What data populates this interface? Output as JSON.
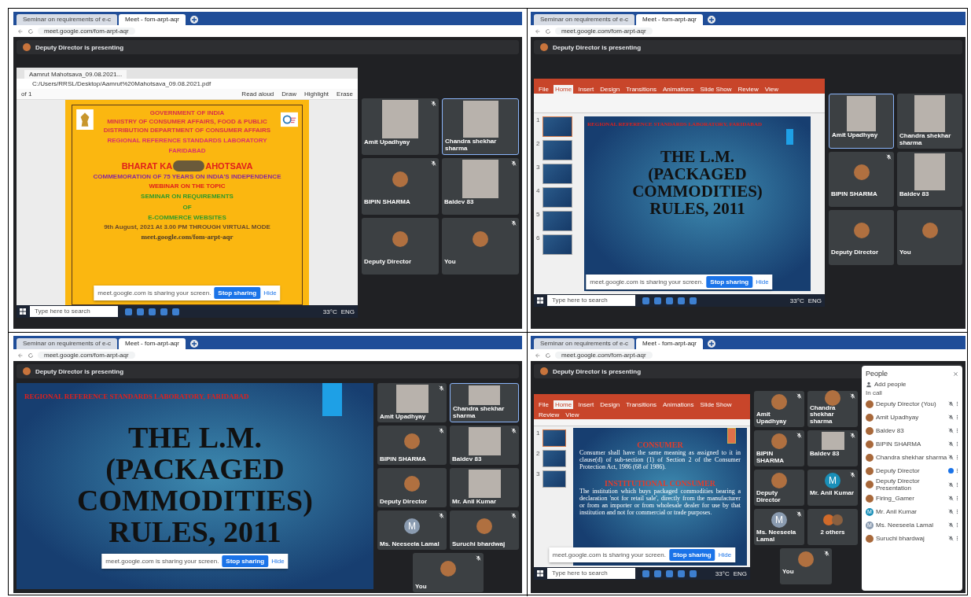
{
  "panels": [
    {
      "browser": {
        "tabs": [
          {
            "title": "Seminar on requirements of e-c",
            "selected": false
          },
          {
            "title": "Meet - fom-arpt-aqr",
            "selected": true
          }
        ],
        "url": "meet.google.com/fom-arpt-aqr"
      },
      "presenting": "Deputy Director is presenting",
      "share": {
        "kind": "pdf",
        "tab": "Aamrut Mahotsava_09.08.2021...",
        "path": "C:/Users/RRSL/Desktop/Aamrut%20Mahotsava_09.08.2021.pdf",
        "page_count": "of 1",
        "tools": [
          "Read aloud",
          "Draw",
          "Highlight",
          "Erase"
        ],
        "lines": [
          {
            "kind": "small",
            "text": "GOVERNMENT OF INDIA",
            "color": "#d8324a"
          },
          {
            "kind": "small",
            "text": "MINISTRY OF CONSUMER AFFAIRS, FOOD & PUBLIC",
            "color": "#d8324a"
          },
          {
            "kind": "small",
            "text": "DISTRIBUTION DEPARTMENT OF CONSUMER AFFAIRS",
            "color": "#d8324a"
          },
          {
            "kind": "medium",
            "text": "REGIONAL REFERENCE STANDARDS LABORATORY",
            "color": "#d8326e"
          },
          {
            "kind": "medium",
            "text": "FARIDABAD",
            "color": "#d8326e"
          },
          {
            "kind": "covered",
            "before": "BHARAT KA",
            "after": "AHOTSAVA",
            "color": "#e0201c"
          },
          {
            "kind": "small",
            "text": "COMMEMORATION OF 75 YEARS ON INDIA'S INDEPENDENCE",
            "color": "#8a2a9a"
          },
          {
            "kind": "medium",
            "text": "WEBINAR ON THE TOPIC",
            "color": "#e0201c"
          },
          {
            "kind": "medium",
            "text": "SEMINAR ON REQUIREMENTS",
            "color": "#2f9a2a"
          },
          {
            "kind": "medium",
            "text": "OF",
            "color": "#2f9a2a"
          },
          {
            "kind": "medium",
            "text": "E-COMMERCE WEBSITES",
            "color": "#2f9a2a"
          },
          {
            "kind": "small",
            "text": "9th August, 2021 At 3.00 PM THROUGH VIRTUAL MODE",
            "color": "#6a4a2a"
          },
          {
            "kind": "serif",
            "text": "meet.google.com/fom-arpt-aqr",
            "color": "#4a3a2a"
          }
        ],
        "taskbar": {
          "search": "Type here to search",
          "weather": "33°C",
          "language": "ENG"
        },
        "share_bar": {
          "message": "meet.google.com is sharing your screen.",
          "stop": "Stop sharing",
          "hide": "Hide"
        }
      },
      "tiles": [
        {
          "name": "Amit Upadhyay",
          "kind": "video",
          "highlighted": false,
          "muted": true
        },
        {
          "name": "Chandra shekhar sharma",
          "kind": "video",
          "highlighted": true,
          "muted": false
        },
        {
          "name": "BIPIN SHARMA",
          "kind": "avatar",
          "highlighted": false,
          "muted": true
        },
        {
          "name": "Baldev 83",
          "kind": "video",
          "highlighted": false,
          "muted": true
        },
        {
          "name": "Deputy Director",
          "kind": "avatar",
          "highlighted": false,
          "muted": false
        },
        {
          "name": "You",
          "kind": "avatar",
          "highlighted": false,
          "muted": true
        }
      ]
    },
    {
      "browser": {
        "tabs": [
          {
            "title": "Seminar on requirements of e-c",
            "selected": false
          },
          {
            "title": "Meet - fom-arpt-aqr",
            "selected": true
          }
        ],
        "url": "meet.google.com/fom-arpt-aqr"
      },
      "presenting": "Deputy Director is presenting",
      "share": {
        "kind": "ppt",
        "ribbon_tabs": [
          {
            "label": "File",
            "selected": false
          },
          {
            "label": "Home",
            "selected": true
          },
          {
            "label": "Insert",
            "selected": false
          },
          {
            "label": "Design",
            "selected": false
          },
          {
            "label": "Transitions",
            "selected": false
          },
          {
            "label": "Animations",
            "selected": false
          },
          {
            "label": "Slide Show",
            "selected": false
          },
          {
            "label": "Review",
            "selected": false
          },
          {
            "label": "View",
            "selected": false
          }
        ],
        "thumbnails": [
          {
            "number": "1",
            "selected": true
          },
          {
            "number": "2",
            "selected": false
          },
          {
            "number": "3",
            "selected": false
          },
          {
            "number": "4",
            "selected": false
          },
          {
            "number": "5",
            "selected": false
          },
          {
            "number": "6",
            "selected": false
          }
        ],
        "slide": {
          "kind": "title",
          "header": "REGIONAL REFERENCE STANDARDS LABORATORY, FARIDABAD",
          "lines": [
            "THE L.M.",
            "(PACKAGED",
            "COMMODITIES)",
            "RULES, 2011"
          ]
        },
        "taskbar": {
          "search": "Type here to search",
          "weather": "33°C",
          "language": "ENG"
        },
        "share_bar": {
          "message": "meet.google.com is sharing your screen.",
          "stop": "Stop sharing",
          "hide": "Hide"
        }
      },
      "tiles": [
        {
          "name": "Amit Upadhyay",
          "kind": "video",
          "highlighted": true,
          "muted": false
        },
        {
          "name": "Chandra shekhar sharma",
          "kind": "video",
          "highlighted": false,
          "muted": false
        },
        {
          "name": "BIPIN SHARMA",
          "kind": "avatar",
          "highlighted": false,
          "muted": true
        },
        {
          "name": "Baldev 83",
          "kind": "video",
          "highlighted": false,
          "muted": false
        },
        {
          "name": "Deputy Director",
          "kind": "avatar",
          "highlighted": false,
          "muted": false
        },
        {
          "name": "You",
          "kind": "avatar",
          "highlighted": false,
          "muted": false
        }
      ]
    },
    {
      "browser": {
        "tabs": [
          {
            "title": "Seminar on requirements of e-c",
            "selected": false
          },
          {
            "title": "Meet - fom-arpt-aqr",
            "selected": true
          }
        ],
        "url": "meet.google.com/fom-arpt-aqr"
      },
      "presenting": "Deputy Director is presenting",
      "share": {
        "kind": "slide",
        "slide": {
          "kind": "title",
          "header": "REGIONAL REFERENCE STANDARDS LABORATORY, FARIDABAD",
          "lines": [
            "THE L.M.",
            "(PACKAGED",
            "COMMODITIES)",
            "RULES, 2011"
          ]
        },
        "share_bar": {
          "message": "meet.google.com is sharing your screen.",
          "stop": "Stop sharing",
          "hide": "Hide"
        }
      },
      "tiles": [
        {
          "name": "Amit Upadhyay",
          "kind": "video",
          "highlighted": false,
          "muted": true
        },
        {
          "name": "Chandra shekhar sharma",
          "kind": "video",
          "highlighted": true,
          "muted": false
        },
        {
          "name": "BIPIN SHARMA",
          "kind": "avatar",
          "highlighted": false,
          "muted": true
        },
        {
          "name": "Baldev 83",
          "kind": "video",
          "highlighted": false,
          "muted": true
        },
        {
          "name": "Deputy Director",
          "kind": "avatar",
          "highlighted": false,
          "muted": false
        },
        {
          "name": "Mr. Anil Kumar",
          "kind": "video",
          "highlighted": false,
          "muted": false
        },
        {
          "name": "Ms. Neeseela Lamal",
          "kind": "letter",
          "letter": "M",
          "color": "#8a9bb0",
          "highlighted": false,
          "muted": true
        },
        {
          "name": "Suruchi bhardwaj",
          "kind": "avatar",
          "highlighted": false,
          "muted": true
        },
        {
          "name": "You",
          "kind": "avatar",
          "highlighted": false,
          "muted": true
        }
      ]
    },
    {
      "browser": {
        "tabs": [
          {
            "title": "Seminar on requirements of e-c",
            "selected": false
          },
          {
            "title": "Meet - fom-arpt-aqr",
            "selected": true
          }
        ],
        "url": "meet.google.com/fom-arpt-aqr"
      },
      "presenting": "Deputy Director is presenting",
      "share": {
        "kind": "ppt",
        "ribbon_tabs": [
          {
            "label": "File",
            "selected": false
          },
          {
            "label": "Home",
            "selected": true
          },
          {
            "label": "Insert",
            "selected": false
          },
          {
            "label": "Design",
            "selected": false
          },
          {
            "label": "Transitions",
            "selected": false
          },
          {
            "label": "Animations",
            "selected": false
          },
          {
            "label": "Slide Show",
            "selected": false
          },
          {
            "label": "Review",
            "selected": false
          },
          {
            "label": "View",
            "selected": false
          }
        ],
        "thumbnails": [
          {
            "number": "1",
            "selected": true
          },
          {
            "number": "2",
            "selected": false
          },
          {
            "number": "3",
            "selected": false
          }
        ],
        "slide": {
          "kind": "definitions",
          "sections": [
            {
              "heading": "CONSUMER",
              "body": "Consumer shall have the same meaning as assigned to it in clause(d) of sub-section (1) of Section 2 of the Consumer Protection Act, 1986 (68 of 1986)."
            },
            {
              "heading": "INSTITUTIONAL CONSUMER",
              "body": "The institution which buys packaged commodities bearing a declaration 'not for retail sale', directly from the manufacturer or from an importer or from wholesale dealer for use by that institution and not for commercial or trade purposes."
            }
          ]
        },
        "taskbar": {
          "search": "Type here to search",
          "weather": "33°C",
          "language": "ENG"
        },
        "share_bar": {
          "message": "meet.google.com is sharing your screen.",
          "stop": "Stop sharing",
          "hide": "Hide"
        }
      },
      "tiles": [
        {
          "name": "Amit Upadhyay",
          "kind": "avatar",
          "highlighted": false,
          "muted": true
        },
        {
          "name": "Chandra shekhar sharma",
          "kind": "avatar",
          "highlighted": false,
          "muted": true
        },
        {
          "name": "BIPIN SHARMA",
          "kind": "avatar",
          "highlighted": false,
          "muted": true
        },
        {
          "name": "Baldev 83",
          "kind": "video",
          "highlighted": false,
          "muted": true
        },
        {
          "name": "Deputy Director",
          "kind": "avatar",
          "highlighted": false,
          "muted": false
        },
        {
          "name": "Mr. Anil Kumar",
          "kind": "letter",
          "letter": "M",
          "color": "#1a8fb8",
          "highlighted": false,
          "muted": true
        },
        {
          "name": "Ms. Neeseela Lamal",
          "kind": "letter",
          "letter": "M",
          "color": "#8a9bb0",
          "highlighted": false,
          "muted": true
        },
        {
          "name": "2 others",
          "kind": "group",
          "highlighted": false,
          "muted": false
        },
        {
          "name": "You",
          "kind": "avatar",
          "highlighted": false,
          "muted": true
        }
      ],
      "people": {
        "title": "People",
        "add": "Add people",
        "section": "In call",
        "members": [
          {
            "name": "Deputy Director (You)",
            "kind": "photo",
            "speaking": false
          },
          {
            "name": "Amit Upadhyay",
            "kind": "photo",
            "speaking": false
          },
          {
            "name": "Baldev 83",
            "kind": "photo",
            "speaking": false
          },
          {
            "name": "BIPIN SHARMA",
            "kind": "photo",
            "speaking": false
          },
          {
            "name": "Chandra shekhar sharma",
            "kind": "photo",
            "speaking": false
          },
          {
            "name": "Deputy Director",
            "kind": "photo",
            "speaking": true
          },
          {
            "name": "Deputy Director",
            "sub": "Presentation",
            "kind": "photo",
            "speaking": false
          },
          {
            "name": "Firing_Gamer",
            "kind": "photo",
            "speaking": false
          },
          {
            "name": "Mr. Anil Kumar",
            "kind": "letter",
            "letter": "M",
            "color": "#1a8fb8",
            "speaking": false
          },
          {
            "name": "Ms. Neeseela Lamal",
            "kind": "letter",
            "letter": "M",
            "color": "#8a9bb0",
            "speaking": false
          },
          {
            "name": "Suruchi bhardwaj",
            "kind": "photo",
            "speaking": false
          }
        ]
      }
    }
  ]
}
